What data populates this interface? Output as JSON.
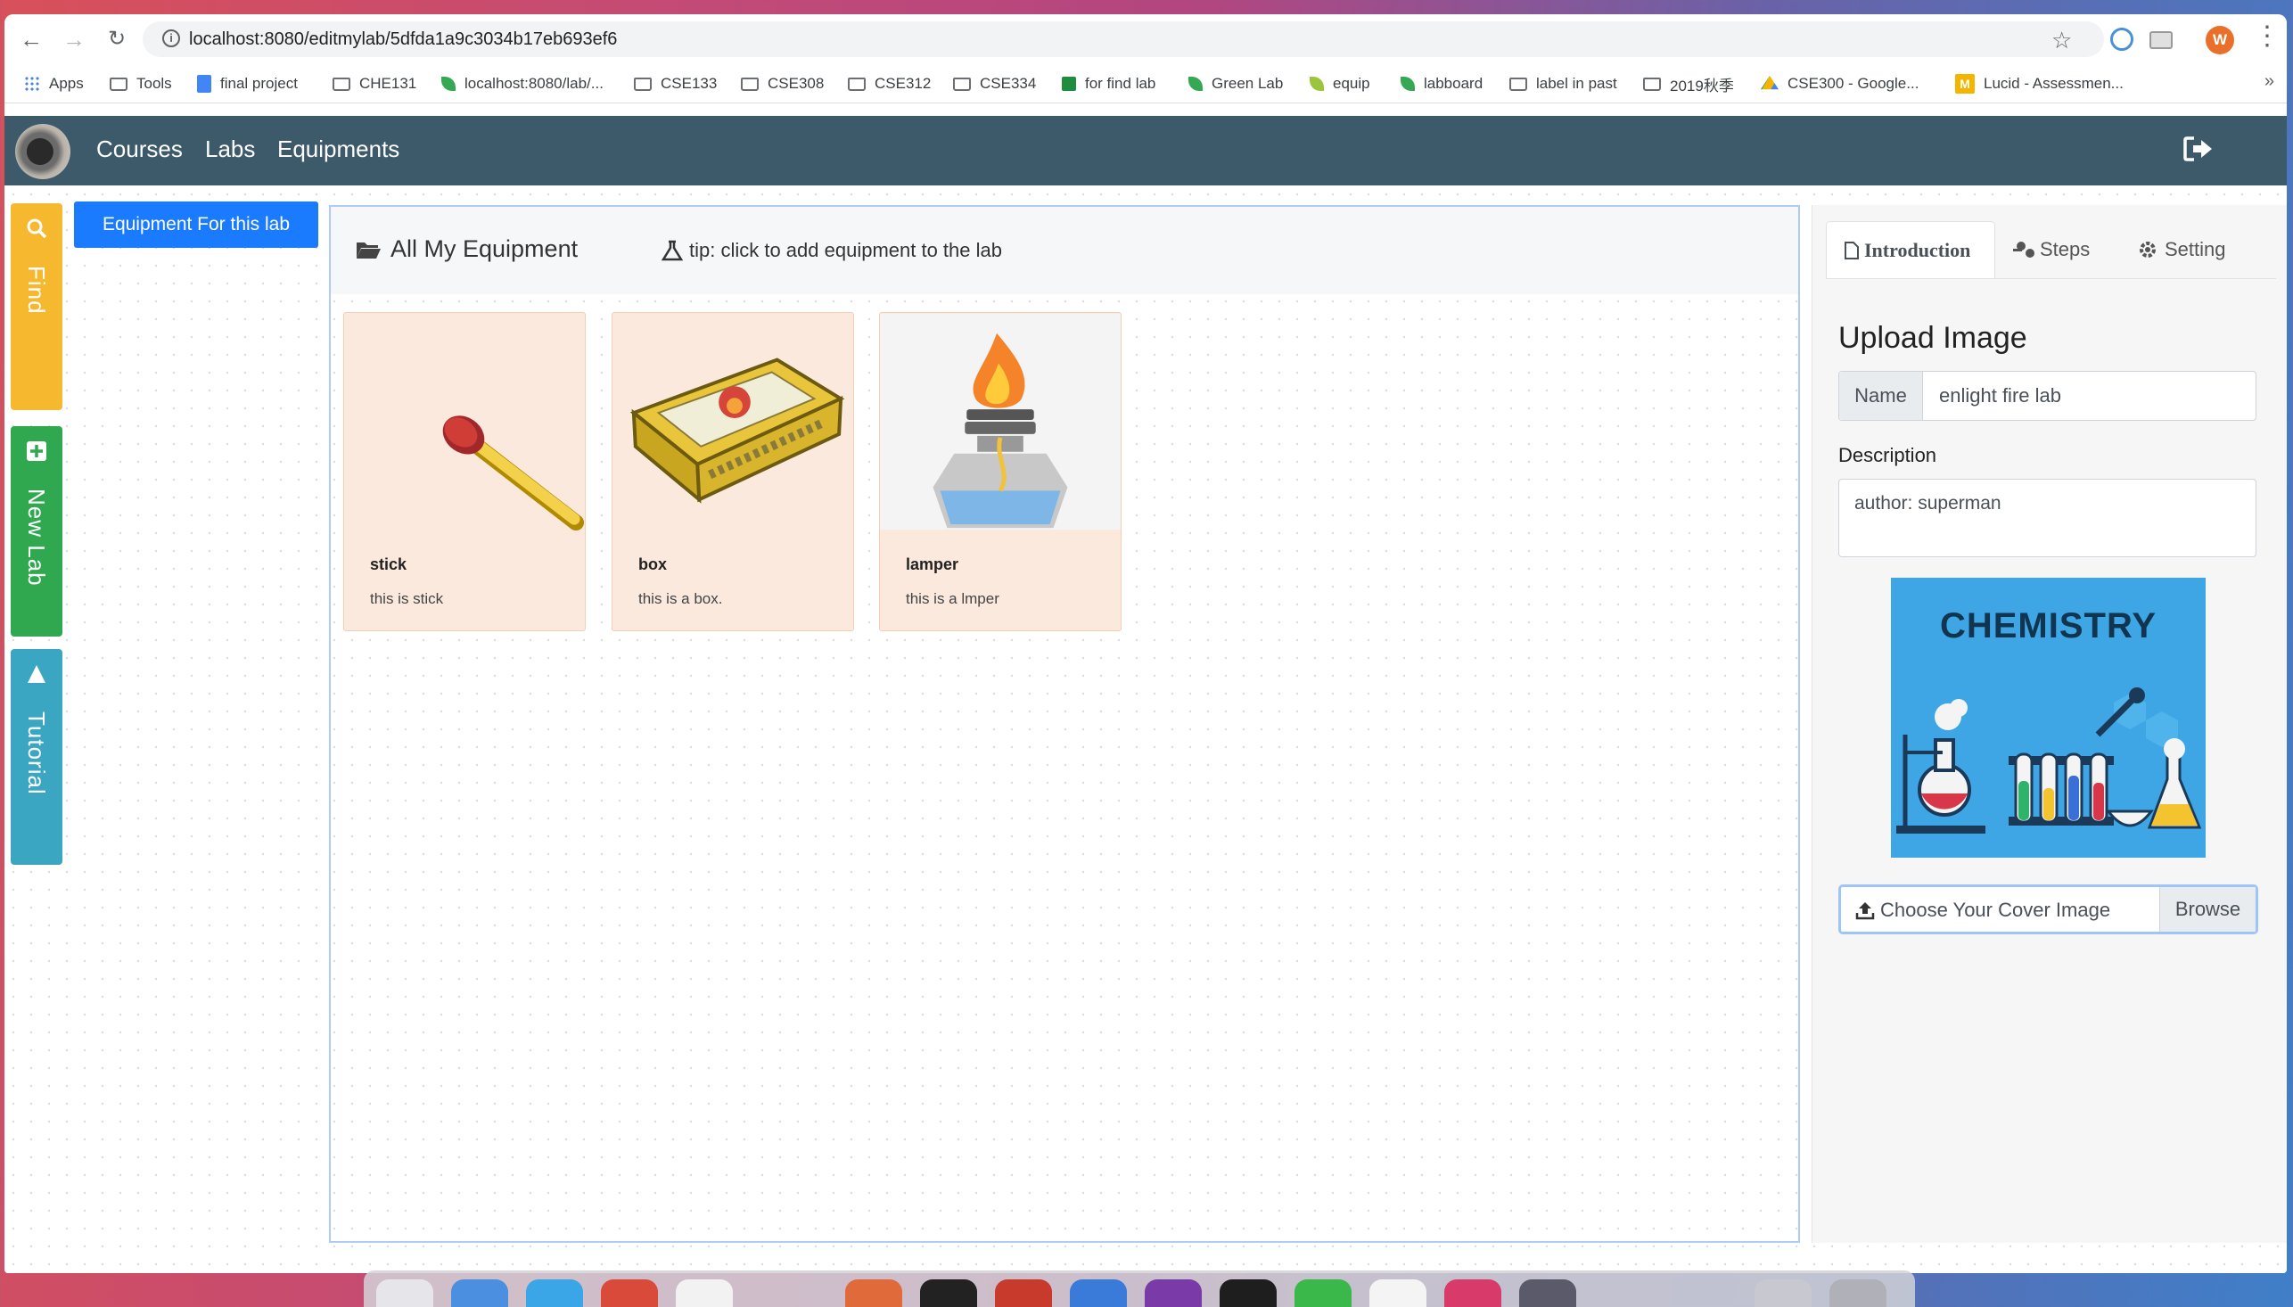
{
  "browser": {
    "url": "localhost:8080/editmylab/5dfda1a9c3034b17eb693ef6",
    "profile_initial": "W",
    "bookmarks": [
      {
        "label": "Apps",
        "icon": "apps-grid-icon"
      },
      {
        "label": "Tools",
        "icon": "folder-icon"
      },
      {
        "label": "final project",
        "icon": "doc-icon"
      },
      {
        "label": "CHE131",
        "icon": "folder-icon"
      },
      {
        "label": "localhost:8080/lab/...",
        "icon": "leaf-icon"
      },
      {
        "label": "CSE133",
        "icon": "folder-icon"
      },
      {
        "label": "CSE308",
        "icon": "folder-icon"
      },
      {
        "label": "CSE312",
        "icon": "folder-icon"
      },
      {
        "label": "CSE334",
        "icon": "folder-icon"
      },
      {
        "label": "for find lab",
        "icon": "leaf-icon"
      },
      {
        "label": "Green Lab",
        "icon": "leaf-icon"
      },
      {
        "label": "equip",
        "icon": "leaf-icon"
      },
      {
        "label": "labboard",
        "icon": "leaf-icon"
      },
      {
        "label": "label in past",
        "icon": "folder-icon"
      },
      {
        "label": "2019秋季",
        "icon": "folder-icon"
      },
      {
        "label": "CSE300 - Google...",
        "icon": "drive-icon"
      },
      {
        "label": "Lucid - Assessmen...",
        "icon": "lucid-icon"
      }
    ]
  },
  "navbar": {
    "links": [
      "Courses",
      "Labs",
      "Equipments"
    ]
  },
  "sidebar": {
    "tabs": [
      {
        "label": "Find",
        "color": "#f5b82e",
        "icon": "search-icon"
      },
      {
        "label": "New Lab",
        "color": "#2fa84f",
        "icon": "plus-square-icon"
      },
      {
        "label": "Tutorial",
        "color": "#3aa6c1",
        "icon": "play-icon"
      }
    ]
  },
  "equipment_for_lab_button": "Equipment For this lab",
  "equipment_panel": {
    "title": "All My Equipment",
    "tip": "tip: click to add equipment to the lab",
    "items": [
      {
        "name": "stick",
        "description": "this is stick",
        "image": "match-stick"
      },
      {
        "name": "box",
        "description": "this is a box.",
        "image": "matchbox"
      },
      {
        "name": "lamper",
        "description": "this is a lmper",
        "image": "alcohol-lamp"
      }
    ]
  },
  "right_panel": {
    "tabs": [
      {
        "label": "Introduction",
        "active": true,
        "icon": "file-icon"
      },
      {
        "label": "Steps",
        "active": false,
        "icon": "steps-icon"
      },
      {
        "label": "Setting",
        "active": false,
        "icon": "gear-icon"
      }
    ],
    "heading": "Upload Image",
    "name_label": "Name",
    "name_value": "enlight fire lab",
    "description_label": "Description",
    "description_value": "author: superman",
    "cover_image_text": "CHEMISTRY",
    "file_placeholder": "Choose Your Cover Image",
    "browse_label": "Browse"
  },
  "colors": {
    "navbar": "#3d5a6a",
    "primary": "#1a7bff",
    "card_bg": "#fbe9de"
  }
}
